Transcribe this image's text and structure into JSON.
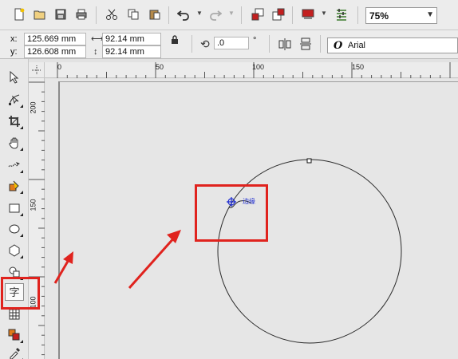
{
  "standard_toolbar": {
    "icons": [
      "new-icon",
      "open-icon",
      "save-icon",
      "print-icon",
      "cut-icon",
      "copy-icon",
      "paste-icon",
      "undo-icon",
      "redo-icon",
      "import-icon",
      "export-icon",
      "app-launcher-icon",
      "options-icon"
    ],
    "zoom_value": "75%"
  },
  "property_bar": {
    "x_label": "x:",
    "x_value": "125.669 mm",
    "y_label": "y:",
    "y_value": "126.608 mm",
    "width_value": "92.14 mm",
    "height_value": "92.14 mm",
    "rotation_value": ".0",
    "rotation_unit": "°",
    "font_icon": "O",
    "font_name": "Arial"
  },
  "rulers": {
    "horizontal_ticks": [
      "0",
      "50",
      "100",
      "150"
    ],
    "vertical_ticks": [
      "200",
      "150",
      "100"
    ]
  },
  "toolbox": {
    "tools": [
      "pick-tool",
      "shape-tool",
      "crop-tool",
      "pan-tool",
      "freehand-tool",
      "smart-fill-tool",
      "rectangle-tool",
      "ellipse-tool",
      "polygon-tool",
      "basic-shapes-tool",
      "text-tool",
      "table-tool",
      "interactive-tool",
      "eyedropper-tool"
    ],
    "text_tool_glyph": "字"
  },
  "canvas": {
    "annotation_label": "边缘",
    "highlight_color": "#e0231e",
    "annotation_color": "#1d2bd0"
  }
}
